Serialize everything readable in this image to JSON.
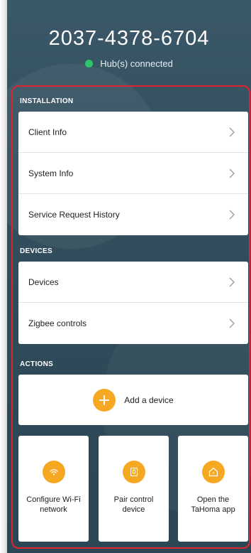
{
  "header": {
    "hub_id": "2037-4378-6704",
    "status_text": "Hub(s) connected",
    "status_color": "#2ec46d"
  },
  "installation": {
    "section_label": "INSTALLATION",
    "items": [
      {
        "label": "Client Info"
      },
      {
        "label": "System Info"
      },
      {
        "label": "Service Request History"
      }
    ]
  },
  "devices": {
    "section_label": "DEVICES",
    "items": [
      {
        "label": "Devices"
      },
      {
        "label": "Zigbee controls"
      }
    ]
  },
  "actions": {
    "section_label": "ACTIONS",
    "add_device": {
      "label": "Add a device",
      "icon": "plus-icon"
    },
    "tiles": [
      {
        "label": "Configure Wi-Fi network",
        "icon": "wifi-icon"
      },
      {
        "label": "Pair control device",
        "icon": "remote-control-icon"
      },
      {
        "label": "Open the TaHoma app",
        "icon": "home-icon"
      }
    ]
  },
  "colors": {
    "accent": "#f6a823",
    "highlight_outline": "#e0242f",
    "background": "#34505f"
  }
}
